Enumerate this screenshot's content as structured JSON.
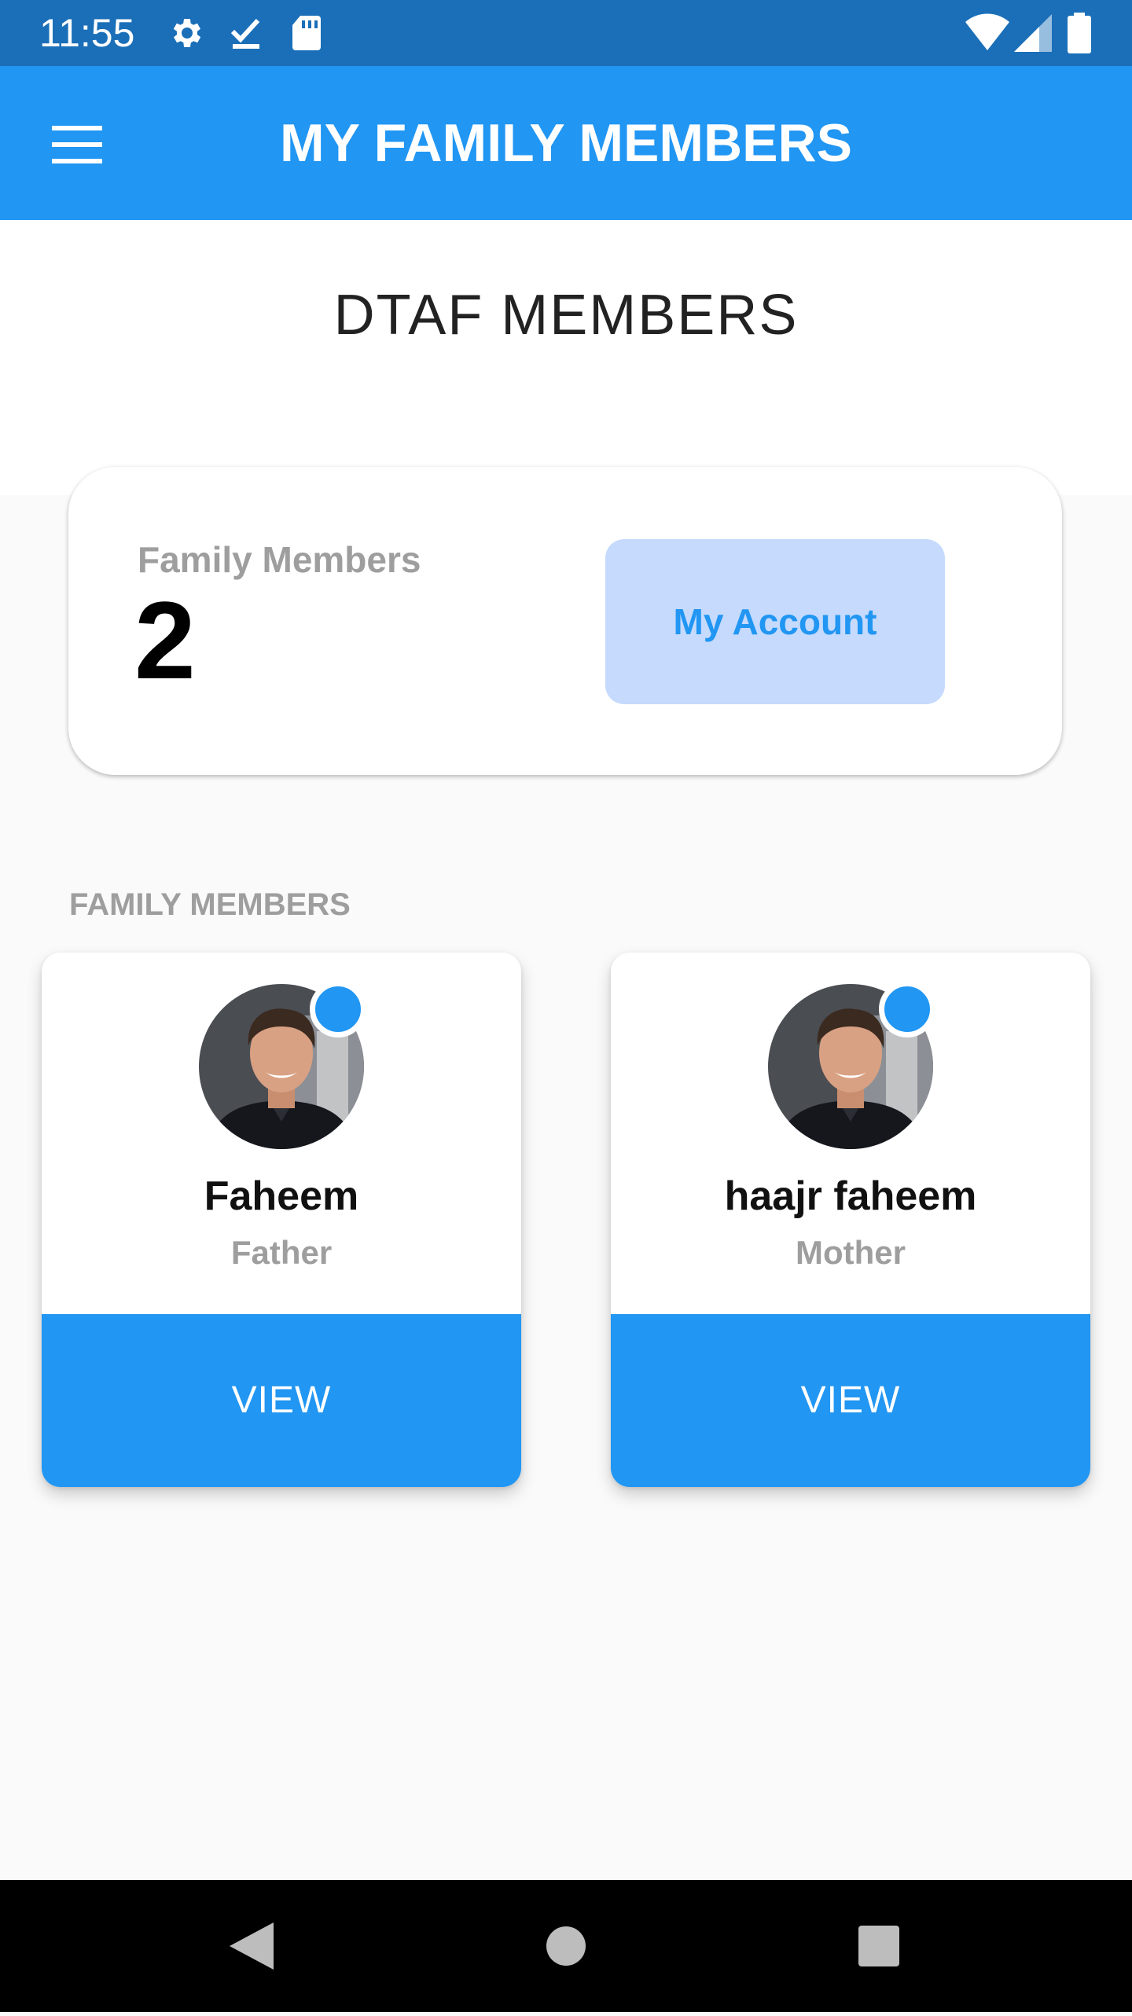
{
  "status_bar": {
    "time": "11:55",
    "left_icons": [
      "gear-icon",
      "download-done-icon",
      "sd-card-icon"
    ],
    "right_icons": [
      "wifi-icon",
      "signal-icon",
      "battery-icon"
    ]
  },
  "app_bar": {
    "title": "MY FAMILY MEMBERS",
    "menu_icon": "menu-icon",
    "color": "#2196f3"
  },
  "header": {
    "title": "DTAF MEMBERS"
  },
  "summary": {
    "label": "Family Members",
    "count": "2",
    "account_button": "My Account"
  },
  "members": {
    "heading": "FAMILY MEMBERS",
    "items": [
      {
        "name": "Faheem",
        "relation": "Father",
        "button": "VIEW"
      },
      {
        "name": "haajr faheem",
        "relation": "Mother",
        "button": "VIEW"
      }
    ]
  },
  "nav_bar": {
    "buttons": [
      "back-icon",
      "home-icon",
      "recents-icon"
    ]
  },
  "colors": {
    "primary": "#2196f3",
    "status_bar": "#1a6fb8",
    "account_button_bg": "#c5dafc"
  }
}
